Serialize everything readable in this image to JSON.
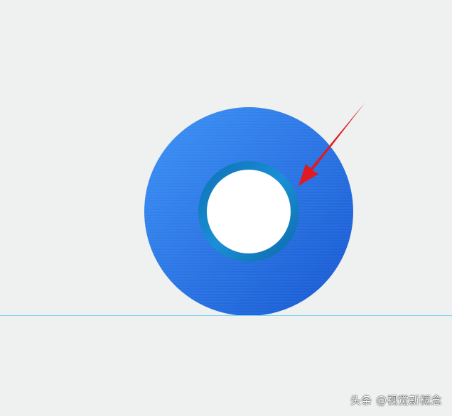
{
  "watermark": {
    "text": "头条 @视觉新概念"
  },
  "colors": {
    "background": "#eff0f0",
    "disc_light": "#3a8df2",
    "disc_dark": "#1a5fd6",
    "inner_ring": "#1386cc",
    "inner_ring_dark": "#0d6fae",
    "hole": "#ffffff",
    "arrow": "#e01a22",
    "guide_line": "#7fd4f4"
  },
  "icons": {
    "disc": "blue-donut-disc",
    "arrow": "red-pointer-arrow"
  }
}
